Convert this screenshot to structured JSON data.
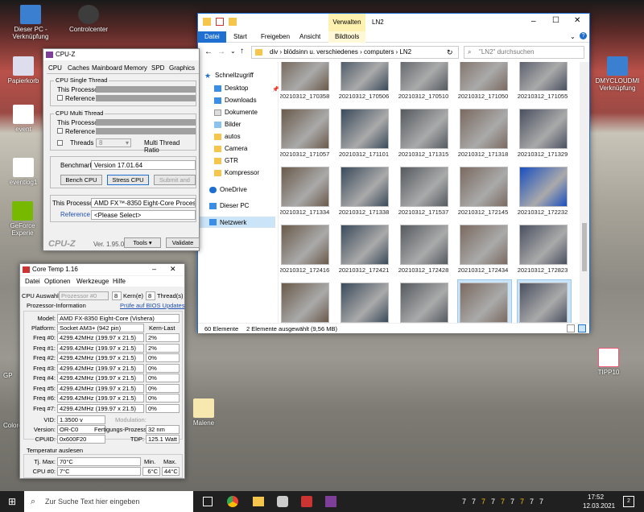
{
  "desktop": {
    "icons": [
      {
        "label": "Dieser PC - Verknüpfung"
      },
      {
        "label": "Controlcenter"
      },
      {
        "label": "Papierkorb"
      },
      {
        "label": "event"
      },
      {
        "label": "eventlog1"
      },
      {
        "label": "GeForce Experie"
      },
      {
        "label": "DMYCLOUDMI Verknüpfung"
      },
      {
        "label": "Malene"
      },
      {
        "label": "TIPP10"
      },
      {
        "label": "GP"
      },
      {
        "label": "Colore"
      }
    ]
  },
  "explorer": {
    "quick_title": "Verwalten",
    "window_title": "LN2",
    "ribbon_tabs": [
      "Datei",
      "Start",
      "Freigeben",
      "Ansicht",
      "Bildtools"
    ],
    "path": [
      "div",
      "blödsinn u. verschiedenes",
      "computers",
      "LN2"
    ],
    "search_placeholder": "\"LN2\" durchsuchen",
    "nav": [
      {
        "label": "Schnellzugriff"
      },
      {
        "label": "Desktop"
      },
      {
        "label": "Downloads"
      },
      {
        "label": "Dokumente"
      },
      {
        "label": "Bilder"
      },
      {
        "label": "autos"
      },
      {
        "label": "Camera"
      },
      {
        "label": "GTR"
      },
      {
        "label": "Kompressor"
      },
      {
        "label": "OneDrive"
      },
      {
        "label": "Dieser PC"
      },
      {
        "label": "Netzwerk"
      }
    ],
    "files": [
      "20210312_170358",
      "20210312_170506",
      "20210312_170510",
      "20210312_171050",
      "20210312_171055",
      "20210312_171057",
      "20210312_171101",
      "20210312_171315",
      "20210312_171318",
      "20210312_171329",
      "20210312_171334",
      "20210312_171338",
      "20210312_171537",
      "20210312_172145",
      "20210312_172232",
      "20210312_172416",
      "20210312_172421",
      "20210312_172428",
      "20210312_172434",
      "20210312_172823",
      "20210312_172839",
      "20210312_172847",
      "20210312_172857",
      "20210312_173333",
      "20210312_173339"
    ],
    "status_count": "60 Elemente",
    "status_selected": "2 Elemente ausgewählt (9,56 MB)"
  },
  "cpuz": {
    "title": "CPU-Z",
    "tabs": [
      "CPU",
      "Caches",
      "Mainboard",
      "Memory",
      "SPD",
      "Graphics"
    ],
    "single_title": "CPU Single Thread",
    "multi_title": "CPU Multi Thread",
    "this_processor": "This Processor",
    "reference": "Reference",
    "threads_label": "Threads",
    "threads_value": "8",
    "ratio_label": "Multi Thread Ratio",
    "bench_label": "Benchmark",
    "bench_version": "Version 17.01.64",
    "bench_cpu": "Bench CPU",
    "stress_cpu": "Stress CPU",
    "submit": "Submit and",
    "proc_label": "This Processor",
    "proc_value": "AMD FX™-8350 Eight-Core Processor",
    "ref_label": "Reference",
    "ref_value": "<Please Select>",
    "brand": "CPU-Z",
    "version": "Ver. 1.95.0.x64",
    "tools": "Tools",
    "validate": "Validate"
  },
  "coretemp": {
    "title": "Core Temp 1.16",
    "menu": [
      "Datei",
      "Optionen",
      "Werkzeuge",
      "Hilfe"
    ],
    "cpu_select_label": "CPU Auswahl:",
    "cpu_select": "Prozessor #0",
    "cores": "8",
    "cores_label": "Kern(e)",
    "threads": "8",
    "threads_label": "Thread(s)",
    "info_label": "Prozessor-Information",
    "bios_link": "Prüfe auf BIOS Updates",
    "model_label": "Model:",
    "model": "AMD FX-8350 Eight-Core (Vishera)",
    "platform_label": "Platform:",
    "platform": "Socket AM3+ (942 pin)",
    "load_label": "Kern-Last",
    "freqs": [
      {
        "label": "Freq #0:",
        "value": "4299.42MHz (199.97 x 21.5)",
        "load": "2%"
      },
      {
        "label": "Freq #1:",
        "value": "4299.42MHz (199.97 x 21.5)",
        "load": "2%"
      },
      {
        "label": "Freq #2:",
        "value": "4299.42MHz (199.97 x 21.5)",
        "load": "0%"
      },
      {
        "label": "Freq #3:",
        "value": "4299.42MHz (199.97 x 21.5)",
        "load": "0%"
      },
      {
        "label": "Freq #4:",
        "value": "4299.42MHz (199.97 x 21.5)",
        "load": "0%"
      },
      {
        "label": "Freq #5:",
        "value": "4299.42MHz (199.97 x 21.5)",
        "load": "0%"
      },
      {
        "label": "Freq #6:",
        "value": "4299.42MHz (199.97 x 21.5)",
        "load": "0%"
      },
      {
        "label": "Freq #7:",
        "value": "4299.42MHz (199.97 x 21.5)",
        "load": "0%"
      }
    ],
    "vid_label": "VID:",
    "vid": "1.3500 v",
    "mod_label": "Modulation:",
    "rev_label": "Version:",
    "rev": "OR-C0",
    "lith_label": "Fertigungs-Prozess:",
    "lith": "32 nm",
    "cpuid_label": "CPUID:",
    "cpuid": "0x600F20",
    "tdp_label": "TDP:",
    "tdp": "125.1 Watt",
    "temp_title": "Temperatur auslesen",
    "tjmax_label": "Tj. Max:",
    "tjmax": "70°C",
    "min_label": "Min.",
    "max_label": "Max.",
    "cpu0_label": "CPU #0:",
    "cpu0": "7°C",
    "cpu0_min": "6°C",
    "cpu0_max": "44°C"
  },
  "taskbar": {
    "search_placeholder": "Zur Suche Text hier eingeben",
    "time": "17:52",
    "date": "12.03.2021",
    "tray_numbers": [
      "7",
      "7",
      "7",
      "7",
      "7",
      "7",
      "7",
      "7",
      "7"
    ],
    "notif_count": "2"
  }
}
